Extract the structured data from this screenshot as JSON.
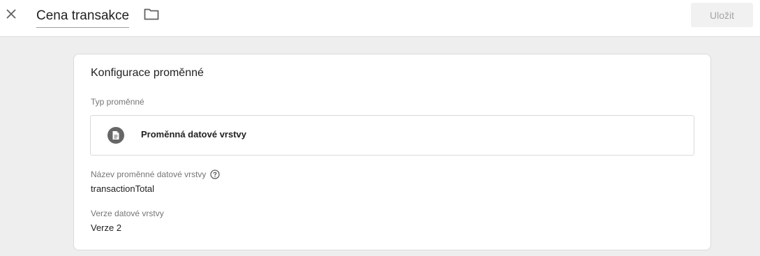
{
  "header": {
    "title": "Cena transakce",
    "save_label": "Uložit"
  },
  "card": {
    "title": "Konfigurace proměnné",
    "variable_type_label": "Typ proměnné",
    "variable_type_value": "Proměnná datové vrstvy",
    "data_layer_name_label": "Název proměnné datové vrstvy",
    "data_layer_name_value": "transactionTotal",
    "data_layer_version_label": "Verze datové vrstvy",
    "data_layer_version_value": "Verze 2"
  },
  "icons": {
    "close": "close-icon",
    "folder": "folder-icon",
    "variable_type": "document-icon",
    "help": "help-icon"
  },
  "colors": {
    "background": "#eeeeee",
    "card": "#ffffff",
    "save_button_bg": "#f1f1f1",
    "save_button_text": "#a5a5a5",
    "type_icon_bg": "#666666"
  }
}
